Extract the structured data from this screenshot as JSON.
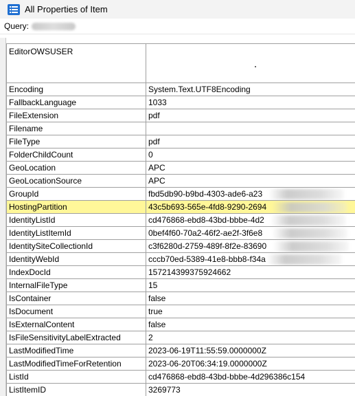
{
  "window": {
    "title": "All Properties of Item",
    "icon": "list-icon"
  },
  "query": {
    "label": "Query:"
  },
  "rows": [
    {
      "key": "EditorOWSUSER",
      "value": ""
    },
    {
      "key": "Encoding",
      "value": "System.Text.UTF8Encoding"
    },
    {
      "key": "FallbackLanguage",
      "value": "1033"
    },
    {
      "key": "FileExtension",
      "value": "pdf"
    },
    {
      "key": "Filename",
      "value": ""
    },
    {
      "key": "FileType",
      "value": "pdf"
    },
    {
      "key": "FolderChildCount",
      "value": "0"
    },
    {
      "key": "GeoLocation",
      "value": "APC"
    },
    {
      "key": "GeoLocationSource",
      "value": "APC"
    },
    {
      "key": "GroupId",
      "value": "fbd5db90-b9bd-4303-ade6-a23"
    },
    {
      "key": "HostingPartition",
      "value": "43c5b693-565e-4fd8-9290-2694"
    },
    {
      "key": "IdentityListId",
      "value": "cd476868-ebd8-43bd-bbbe-4d2"
    },
    {
      "key": "IdentityListItemId",
      "value": "0bef4f60-70a2-46f2-ae2f-3f6e8"
    },
    {
      "key": "IdentitySiteCollectionId",
      "value": "c3f6280d-2759-489f-8f2e-83690"
    },
    {
      "key": "IdentityWebId",
      "value": "cccb70ed-5389-41e8-bbb8-f34a"
    },
    {
      "key": "IndexDocId",
      "value": "157214399375924662"
    },
    {
      "key": "InternalFileType",
      "value": "15"
    },
    {
      "key": "IsContainer",
      "value": "false"
    },
    {
      "key": "IsDocument",
      "value": "true"
    },
    {
      "key": "IsExternalContent",
      "value": "false"
    },
    {
      "key": "IsFileSensitivityLabelExtracted",
      "value": "2"
    },
    {
      "key": "LastModifiedTime",
      "value": "2023-06-19T11:55:59.0000000Z"
    },
    {
      "key": "LastModifiedTimeForRetention",
      "value": "2023-06-20T06:34:19.0000000Z"
    },
    {
      "key": "ListId",
      "value": "cd476868-ebd8-43bd-bbbe-4d296386c154"
    },
    {
      "key": "ListItemID",
      "value": "3269773"
    },
    {
      "key": "",
      "value": ""
    }
  ],
  "highlight_color": "#fff799"
}
